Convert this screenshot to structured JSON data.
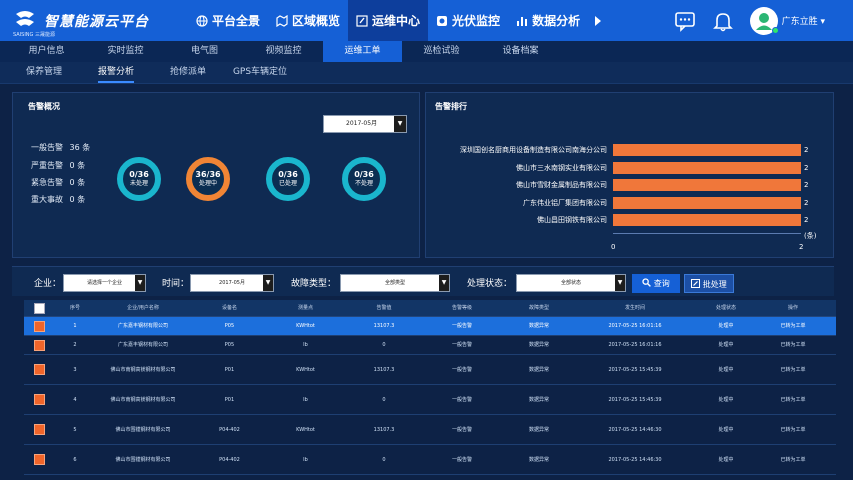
{
  "brand": {
    "title": "智慧能源云平台",
    "sub": "SAISING 三晟能源"
  },
  "main_nav": [
    {
      "label": "平台全景"
    },
    {
      "label": "区域概览"
    },
    {
      "label": "运维中心"
    },
    {
      "label": "光伏监控"
    },
    {
      "label": "数据分析"
    }
  ],
  "user": {
    "name": "广东立胜 ▾"
  },
  "sub_nav": [
    "用户信息",
    "实时监控",
    "电气图",
    "视频监控",
    "运维工单",
    "巡检试验",
    "设备档案"
  ],
  "sub_nav2": [
    "保养管理",
    "报警分析",
    "抢修派单",
    "GPS车辆定位"
  ],
  "overview": {
    "title": "告警概况",
    "date": "2017-05月",
    "stats": [
      {
        "label": "一般告警",
        "value": "36",
        "unit": "条"
      },
      {
        "label": "严重告警",
        "value": "0",
        "unit": "条"
      },
      {
        "label": "紧急告警",
        "value": "0",
        "unit": "条"
      },
      {
        "label": "重大事故",
        "value": "0",
        "unit": "条"
      }
    ],
    "rings": [
      {
        "value": "0/36",
        "label": "未处理",
        "color": "#1ab6cd"
      },
      {
        "value": "36/36",
        "label": "处理中",
        "color": "#f08535"
      },
      {
        "value": "0/36",
        "label": "已处理",
        "color": "#1ab6cd"
      },
      {
        "value": "0/36",
        "label": "不处理",
        "color": "#1ab6cd"
      }
    ]
  },
  "ranking": {
    "title": "告警排行",
    "unit": "(条)"
  },
  "chart_data": {
    "type": "bar",
    "orientation": "horizontal",
    "title": "告警排行",
    "categories": [
      "深圳国创名厨商用设备制造有限公司南海分公司",
      "佛山市三水南钢实业有限公司",
      "佛山市雪财金属制品有限公司",
      "广东伟业铝厂集团有限公司",
      "佛山昌田钢铁有限公司"
    ],
    "values": [
      2,
      2,
      2,
      2,
      2
    ],
    "xlim": [
      0,
      2
    ],
    "xticks": [
      "0",
      "2"
    ],
    "xlabel": "(条)",
    "bar_color": "#f0773a"
  },
  "filters": {
    "company_label": "企业：",
    "company_value": "请选择一个企业",
    "time_label": "时间：",
    "time_value": "2017-05月",
    "fault_label": "故障类型：",
    "fault_value": "全部类型",
    "status_label": "处理状态：",
    "status_value": "全部状态",
    "query": "查询",
    "batch": "批处理"
  },
  "table": {
    "columns": [
      "序号",
      "企业/用户名称",
      "设备名",
      "测量点",
      "告警值",
      "告警等级",
      "故障类型",
      "发生时间",
      "处理状态",
      "操作"
    ],
    "rows": [
      [
        "1",
        "广东嘉丰钢材有限公司",
        "P05",
        "KWHtot",
        "13107.3",
        "一般告警",
        "数据异常",
        "2017-05-25 16:01:16",
        "处理中",
        "已转为工单"
      ],
      [
        "2",
        "广东嘉丰钢材有限公司",
        "P05",
        "Ib",
        "0",
        "一般告警",
        "数据异常",
        "2017-05-25 16:01:16",
        "处理中",
        "已转为工单"
      ],
      [
        "3",
        "佛山市南钢高镁钢材有限公司",
        "P01",
        "KWHtot",
        "13107.3",
        "一般告警",
        "数据异常",
        "2017-05-25 15:45:39",
        "处理中",
        "已转为工单"
      ],
      [
        "4",
        "佛山市南钢高镁钢材有限公司",
        "P01",
        "Ib",
        "0",
        "一般告警",
        "数据异常",
        "2017-05-25 15:45:39",
        "处理中",
        "已转为工单"
      ],
      [
        "5",
        "佛山市围镗钢材有限公司",
        "P04-402",
        "KWHtot",
        "13107.3",
        "一般告警",
        "数据异常",
        "2017-05-25 14:46:30",
        "处理中",
        "已转为工单"
      ],
      [
        "6",
        "佛山市围镗钢材有限公司",
        "P04-402",
        "Ib",
        "0",
        "一般告警",
        "数据异常",
        "2017-05-25 14:46:30",
        "处理中",
        "已转为工单"
      ]
    ]
  },
  "colors": {
    "accent": "#1560d6",
    "alarm": "#f0773a",
    "teal": "#1ab6cd"
  }
}
